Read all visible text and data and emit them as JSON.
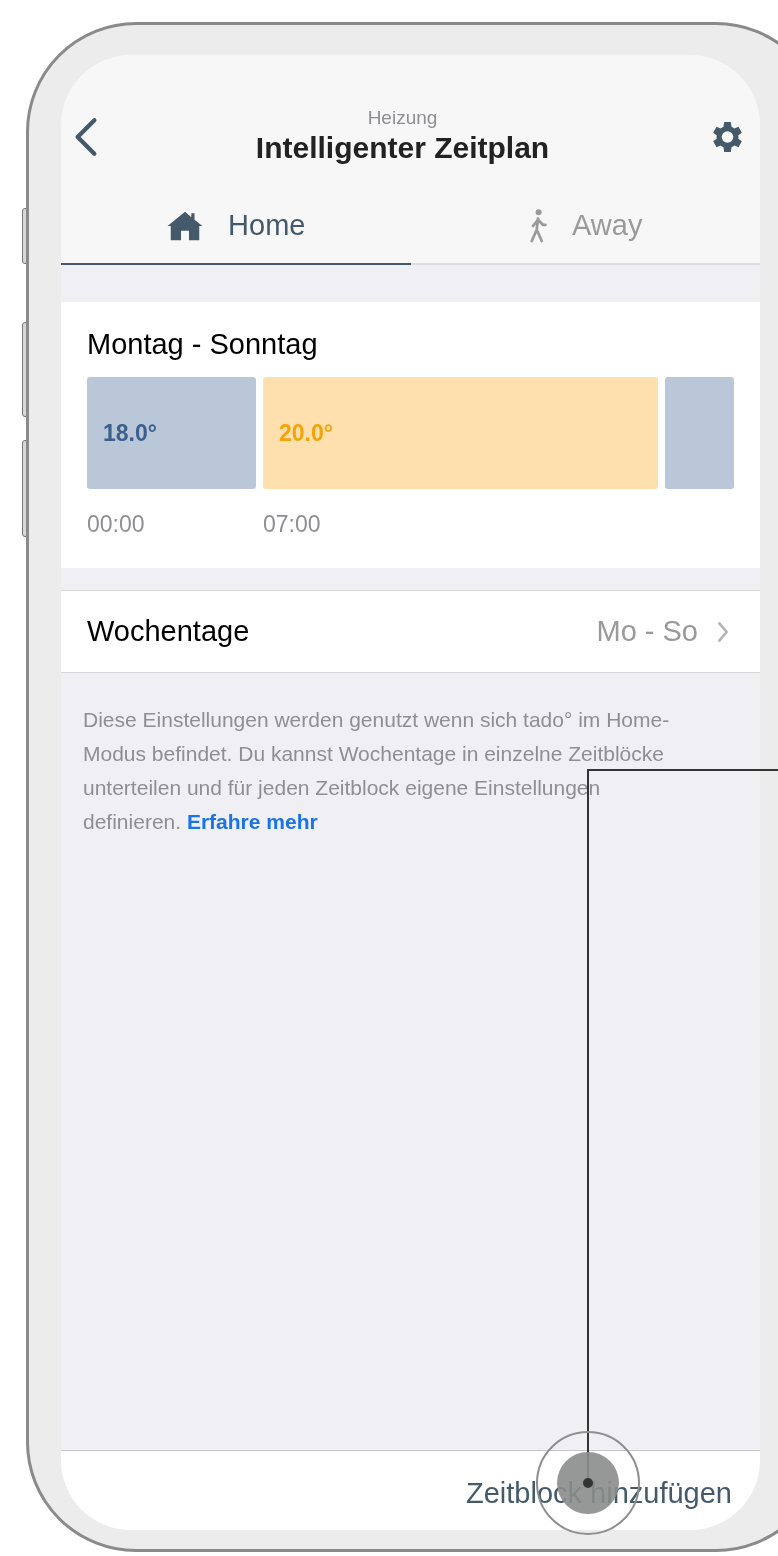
{
  "header": {
    "subtitle": "Heizung",
    "title": "Intelligenter Zeitplan"
  },
  "tabs": [
    {
      "label": "Home",
      "kind": "home",
      "selected": true
    },
    {
      "label": "Away",
      "kind": "away",
      "selected": false
    }
  ],
  "schedule": {
    "title": "Montag - Sonntag",
    "blocks": [
      {
        "kind": "eco",
        "temperature": "18.0°",
        "start": "00:00"
      },
      {
        "kind": "comfort",
        "temperature": "20.0°",
        "start": "07:00"
      },
      {
        "kind": "eco"
      }
    ]
  },
  "weekdays_row": {
    "label": "Wochentage",
    "value": "Mo - So"
  },
  "description": {
    "text": "Diese Einstellungen werden genutzt wenn sich tado° im Home-Modus befindet. Du kannst Wochentage in einzelne Zeitblöcke unterteilen und für jeden Zeitblock eigene Einstellungen definieren.",
    "link": "Erfahre mehr"
  },
  "bottom_action": "Zeitblock hinzufügen"
}
